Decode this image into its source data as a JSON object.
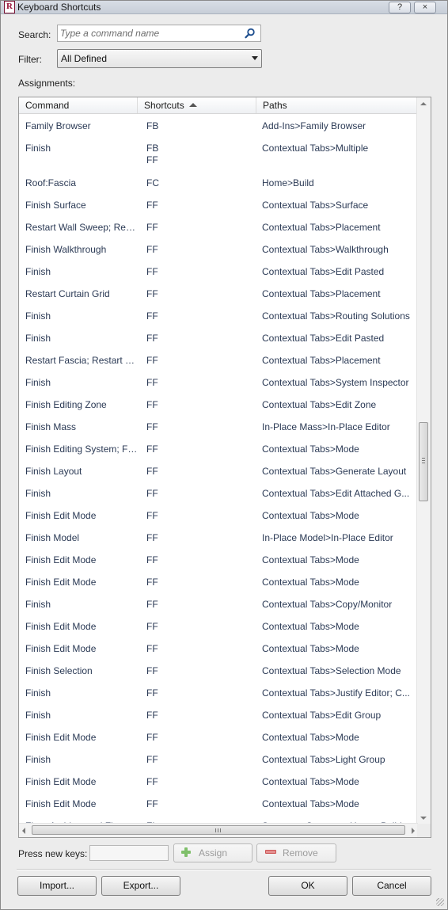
{
  "window": {
    "title": "Keyboard Shortcuts",
    "help_button": "?",
    "close_button": "×"
  },
  "search": {
    "label": "Search:",
    "placeholder": "Type a command name",
    "icon": "search-icon"
  },
  "filter": {
    "label": "Filter:",
    "selected": "All Defined"
  },
  "assignments": {
    "label": "Assignments:",
    "columns": {
      "command": "Command",
      "shortcuts": "Shortcuts",
      "paths": "Paths"
    },
    "sort": {
      "column": "Shortcuts",
      "direction": "ascending"
    },
    "rows": [
      {
        "command": "Family Browser",
        "shortcuts": "FB",
        "path": "Add-Ins>Family Browser"
      },
      {
        "command": "Finish",
        "shortcuts": "FB\nFF",
        "path": "Contextual Tabs>Multiple"
      },
      {
        "command": "Roof:Fascia",
        "shortcuts": "FC",
        "path": "Home>Build"
      },
      {
        "command": "Finish Surface",
        "shortcuts": "FF",
        "path": "Contextual Tabs>Surface"
      },
      {
        "command": "Restart Wall Sweep; Res...",
        "shortcuts": "FF",
        "path": "Contextual Tabs>Placement"
      },
      {
        "command": "Finish Walkthrough",
        "shortcuts": "FF",
        "path": "Contextual Tabs>Walkthrough"
      },
      {
        "command": "Finish",
        "shortcuts": "FF",
        "path": "Contextual Tabs>Edit Pasted"
      },
      {
        "command": "Restart Curtain Grid",
        "shortcuts": "FF",
        "path": "Contextual Tabs>Placement"
      },
      {
        "command": "Finish",
        "shortcuts": "FF",
        "path": "Contextual Tabs>Routing Solutions"
      },
      {
        "command": "Finish",
        "shortcuts": "FF",
        "path": "Contextual Tabs>Edit Pasted"
      },
      {
        "command": "Restart Fascia; Restart G...",
        "shortcuts": "FF",
        "path": "Contextual Tabs>Placement"
      },
      {
        "command": "Finish",
        "shortcuts": "FF",
        "path": "Contextual Tabs>System Inspector"
      },
      {
        "command": "Finish Editing Zone",
        "shortcuts": "FF",
        "path": "Contextual Tabs>Edit Zone"
      },
      {
        "command": "Finish Mass",
        "shortcuts": "FF",
        "path": "In-Place Mass>In-Place Editor"
      },
      {
        "command": "Finish Editing System; Fi...",
        "shortcuts": "FF",
        "path": "Contextual Tabs>Mode"
      },
      {
        "command": "Finish Layout",
        "shortcuts": "FF",
        "path": "Contextual Tabs>Generate Layout"
      },
      {
        "command": "Finish",
        "shortcuts": "FF",
        "path": "Contextual Tabs>Edit Attached G..."
      },
      {
        "command": "Finish Edit Mode",
        "shortcuts": "FF",
        "path": "Contextual Tabs>Mode"
      },
      {
        "command": "Finish Model",
        "shortcuts": "FF",
        "path": "In-Place Model>In-Place Editor"
      },
      {
        "command": "Finish Edit Mode",
        "shortcuts": "FF",
        "path": "Contextual Tabs>Mode"
      },
      {
        "command": "Finish Edit Mode",
        "shortcuts": "FF",
        "path": "Contextual Tabs>Mode"
      },
      {
        "command": "Finish",
        "shortcuts": "FF",
        "path": "Contextual Tabs>Copy/Monitor"
      },
      {
        "command": "Finish Edit Mode",
        "shortcuts": "FF",
        "path": "Contextual Tabs>Mode"
      },
      {
        "command": "Finish Edit Mode",
        "shortcuts": "FF",
        "path": "Contextual Tabs>Mode"
      },
      {
        "command": "Finish Selection",
        "shortcuts": "FF",
        "path": "Contextual Tabs>Selection Mode"
      },
      {
        "command": "Finish",
        "shortcuts": "FF",
        "path": "Contextual Tabs>Justify Editor; C..."
      },
      {
        "command": "Finish",
        "shortcuts": "FF",
        "path": "Contextual Tabs>Edit Group"
      },
      {
        "command": "Finish Edit Mode",
        "shortcuts": "FF",
        "path": "Contextual Tabs>Mode"
      },
      {
        "command": "Finish",
        "shortcuts": "FF",
        "path": "Contextual Tabs>Light Group"
      },
      {
        "command": "Finish Edit Mode",
        "shortcuts": "FF",
        "path": "Contextual Tabs>Mode"
      },
      {
        "command": "Finish Edit Mode",
        "shortcuts": "FF",
        "path": "Contextual Tabs>Mode"
      },
      {
        "command": "Floor:Architectural Floor",
        "shortcuts": "FL",
        "path": "Structure>Structure; Home>Build"
      }
    ]
  },
  "press_keys": {
    "label": "Press new keys:",
    "value": ""
  },
  "buttons": {
    "assign": "Assign",
    "remove": "Remove",
    "import": "Import...",
    "export": "Export...",
    "ok": "OK",
    "cancel": "Cancel"
  }
}
